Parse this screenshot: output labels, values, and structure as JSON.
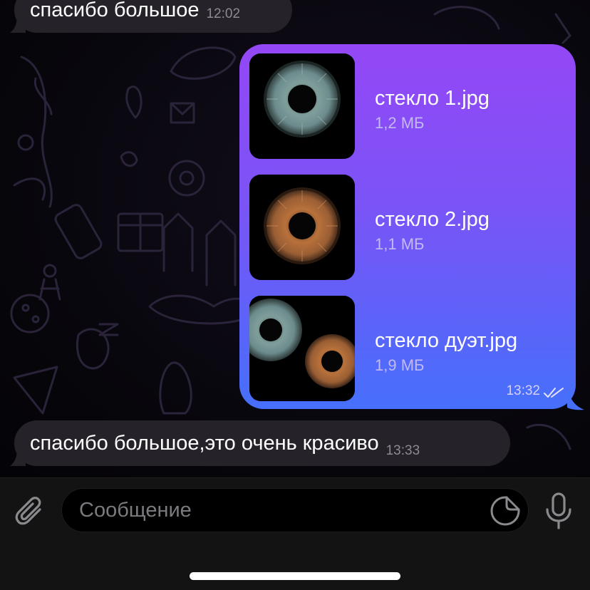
{
  "messages": [
    {
      "direction": "incoming",
      "text": "спасибо большое",
      "time": "12:02"
    },
    {
      "direction": "outgoing",
      "files": [
        {
          "name": "стекло 1.jpg",
          "size": "1,2 МБ",
          "thumbnail": "blue-gray iris"
        },
        {
          "name": "стекло 2.jpg",
          "size": "1,1 МБ",
          "thumbnail": "amber iris"
        },
        {
          "name": "стекло дуэт.jpg",
          "size": "1,9 МБ",
          "thumbnail": "blue-gray and amber irises"
        }
      ],
      "time": "13:32",
      "status": "read",
      "status_icon": "double-check-icon"
    },
    {
      "direction": "incoming",
      "text": "спасибо большое,это очень красиво",
      "time": "13:33"
    }
  ],
  "composer": {
    "placeholder": "Сообщение",
    "value": "",
    "attach_icon": "paperclip-icon",
    "sticker_icon": "sticker-icon",
    "voice_icon": "microphone-icon"
  },
  "colors": {
    "outgoing_gradient_top": "#9447f5",
    "outgoing_gradient_bottom": "#4670fb",
    "incoming_bubble": "#262229",
    "input_bar": "#131313"
  }
}
